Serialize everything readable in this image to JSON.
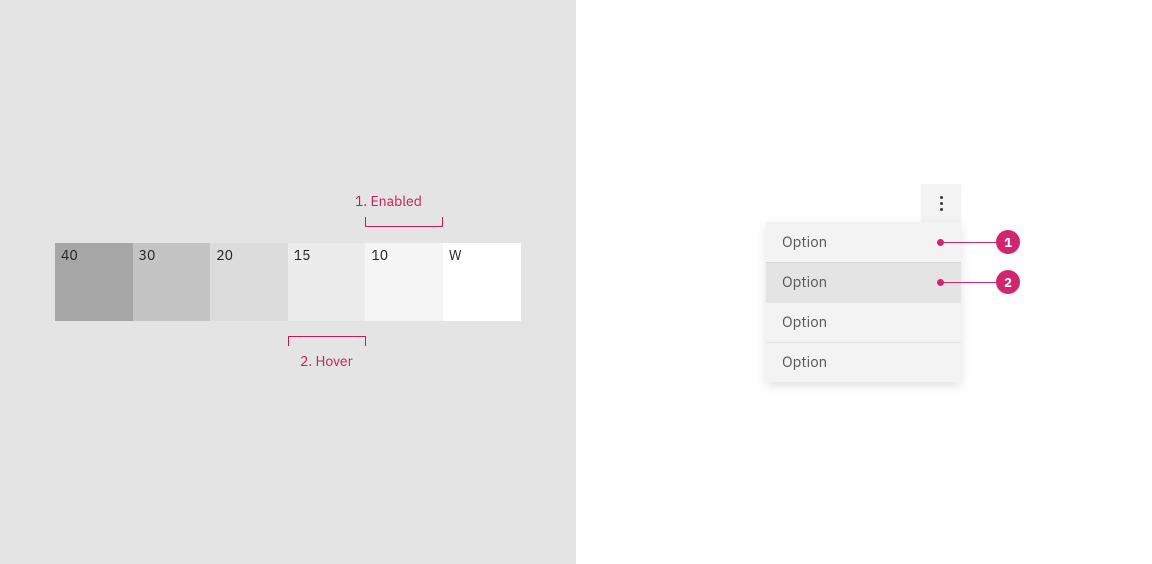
{
  "left": {
    "swatches": [
      {
        "label": "40"
      },
      {
        "label": "30"
      },
      {
        "label": "20"
      },
      {
        "label": "15"
      },
      {
        "label": "10"
      },
      {
        "label": "W"
      }
    ],
    "annotation1": "1. Enabled",
    "annotation2": "2. Hover"
  },
  "right": {
    "items": [
      {
        "label": "Option"
      },
      {
        "label": "Option"
      },
      {
        "label": "Option"
      },
      {
        "label": "Option"
      }
    ],
    "callout1": "1",
    "callout2": "2"
  },
  "colors": {
    "accent": "#d02670"
  }
}
